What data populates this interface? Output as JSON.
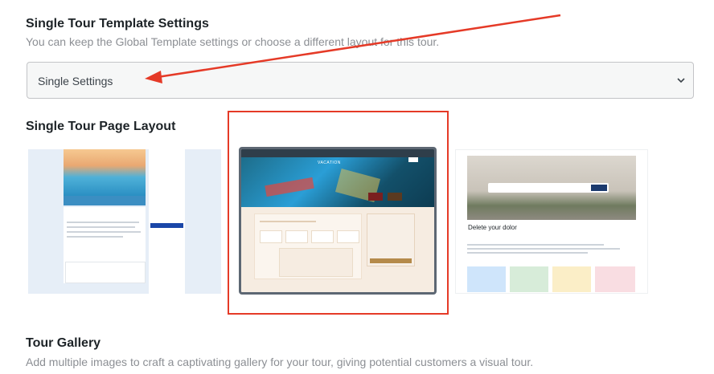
{
  "template_settings": {
    "title": "Single Tour Template Settings",
    "description": "You can keep the Global Template settings or choose a different layout for this tour.",
    "select_value": "Single Settings"
  },
  "page_layout": {
    "title": "Single Tour Page Layout",
    "options": [
      {
        "name": "layout-1",
        "selected": false
      },
      {
        "name": "layout-2",
        "selected": true,
        "brand_text": "VACATION",
        "search_button": "Search"
      },
      {
        "name": "layout-3",
        "selected": false,
        "headline": "Delete your dolor"
      }
    ]
  },
  "gallery": {
    "title": "Tour Gallery",
    "description": "Add multiple images to craft a captivating gallery for your tour, giving potential customers a visual tour."
  },
  "colors": {
    "annotation": "#e53a27",
    "selected_border": "#5d6773",
    "sea": "#2a9ed6"
  }
}
